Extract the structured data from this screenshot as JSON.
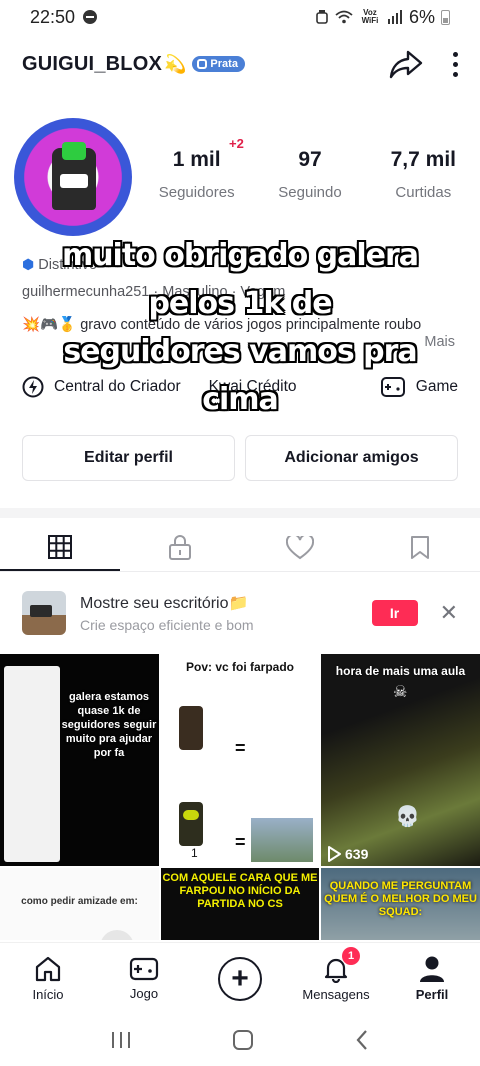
{
  "status_bar": {
    "time": "22:50",
    "network_label": "Voz WiFi",
    "battery_pct": "6%"
  },
  "header": {
    "username": "GUIGUI_BLOX",
    "emoji": "💫",
    "badge": "Prata"
  },
  "profile": {
    "new_followers": "+2",
    "stats": [
      {
        "value": "1 mil",
        "label": "Seguidores"
      },
      {
        "value": "97",
        "label": "Seguindo"
      },
      {
        "value": "7,7 mil",
        "label": "Curtidas"
      }
    ],
    "distinction_label": "Distintivo",
    "handle_line": "guilhermecunha251 · Masculino · Vagem",
    "bio": "💥🎮🥇 gravo conteúdo de vários jogos principalmente roubo",
    "more_label": "Mais",
    "links": [
      {
        "label": "Central do Criador"
      },
      {
        "label": "Kwai Crédito"
      },
      {
        "label": "Game"
      }
    ],
    "buttons": {
      "edit": "Editar perfil",
      "add_friends": "Adicionar amigos"
    }
  },
  "overlay_caption": [
    "muito obrigado galera",
    "pelos 1k de",
    "seguidores vamos pra",
    "cima"
  ],
  "promo": {
    "title": "Mostre seu escritório📁",
    "subtitle": "Crie espaço eficiente e bom",
    "action": "Ir"
  },
  "videos": [
    {
      "caption": "galera estamos quase 1k de seguidores seguir muito pra ajudar por fa"
    },
    {
      "caption": "Pov: vc foi farpado",
      "marks": [
        "=",
        "="
      ],
      "counter": "1"
    },
    {
      "caption": "hora de mais uma aula",
      "views": "639"
    },
    {
      "caption": "como pedir amizade em:"
    },
    {
      "caption": "COM AQUELE CARA QUE ME FARPOU NO INÍCIO DA PARTIDA NO CS"
    },
    {
      "caption": "QUANDO ME PERGUNTAM QUEM É O MELHOR DO MEU SQUAD:"
    }
  ],
  "bottom_nav": {
    "items": [
      {
        "label": "Início",
        "icon": "home-icon"
      },
      {
        "label": "Jogo",
        "icon": "gamepad-icon"
      },
      {
        "label": "",
        "icon": "plus-icon"
      },
      {
        "label": "Mensagens",
        "icon": "bell-icon",
        "badge": "1"
      },
      {
        "label": "Perfil",
        "icon": "person-icon"
      }
    ]
  },
  "colors": {
    "accent": "#fe2c55",
    "badge": "#4a7fd6",
    "text": "#161823",
    "muted": "#73757c"
  }
}
